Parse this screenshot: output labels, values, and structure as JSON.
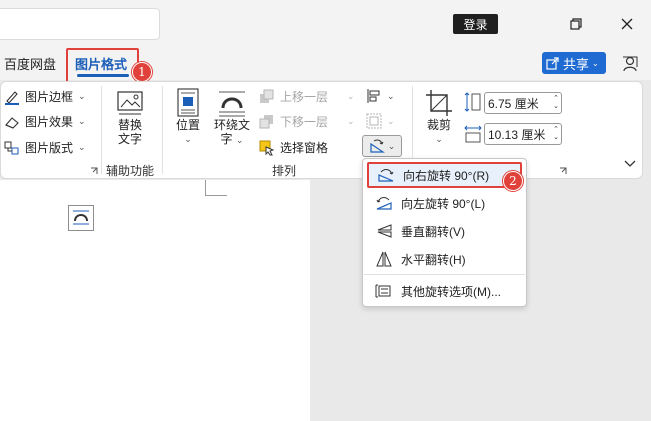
{
  "titlebar": {
    "login_label": "登录"
  },
  "tabs": {
    "baidu_label": "百度网盘",
    "picture_format_label": "图片格式",
    "share_label": "共享",
    "badge_1": "1",
    "badge_2": "2"
  },
  "ribbon": {
    "picture_border": "图片边框",
    "picture_effects": "图片效果",
    "picture_layout": "图片版式",
    "alt_text_line1": "替换",
    "alt_text_line2": "文字",
    "accessibility_group": "辅助功能",
    "position": "位置",
    "wrap_text_line1": "环绕文",
    "wrap_text_line2": "字",
    "bring_forward": "上移一层",
    "send_backward": "下移一层",
    "selection_pane": "选择窗格",
    "arrange_group": "排列",
    "crop": "裁剪",
    "height_value": "6.75 厘米",
    "width_value": "10.13 厘米"
  },
  "menu": {
    "items": [
      {
        "label": "向右旋转 90°(R)",
        "icon": "rotate-right-icon"
      },
      {
        "label": "向左旋转 90°(L)",
        "icon": "rotate-left-icon"
      },
      {
        "label": "垂直翻转(V)",
        "icon": "flip-vertical-icon"
      },
      {
        "label": "水平翻转(H)",
        "icon": "flip-horizontal-icon"
      },
      {
        "label": "其他旋转选项(M)...",
        "icon": "more-rotation-icon"
      }
    ]
  },
  "colors": {
    "accent": "#1c5fb8",
    "highlight_red": "#e0413a",
    "share_blue": "#1f6bd1"
  }
}
